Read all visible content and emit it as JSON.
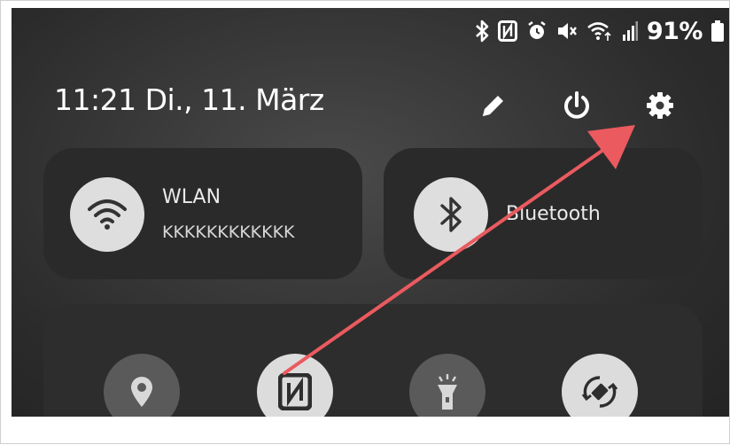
{
  "status_bar": {
    "icons": [
      "bluetooth-icon",
      "nfc-icon",
      "alarm-icon",
      "mute-icon",
      "wifi-icon",
      "signal-icon",
      "battery-icon"
    ],
    "battery_percent": "91%"
  },
  "header": {
    "datetime": "11:21  Di., 11. März",
    "icons": [
      "edit-icon",
      "power-icon",
      "settings-icon"
    ]
  },
  "tiles": {
    "wifi": {
      "title": "WLAN",
      "subtitle": "KKKKKKKKKKKK",
      "icon": "wifi-icon"
    },
    "bluetooth": {
      "title": "Bluetooth",
      "icon": "bluetooth-icon"
    }
  },
  "quick_buttons": [
    {
      "name": "location",
      "icon": "location-icon",
      "active": false
    },
    {
      "name": "nfc",
      "icon": "nfc-icon",
      "active": true
    },
    {
      "name": "flashlight",
      "icon": "flashlight-icon",
      "active": false
    },
    {
      "name": "auto-rotate",
      "icon": "rotate-icon",
      "active": true
    }
  ],
  "annotation": {
    "type": "arrow",
    "color": "#ea5a5f",
    "target": "settings-icon"
  }
}
